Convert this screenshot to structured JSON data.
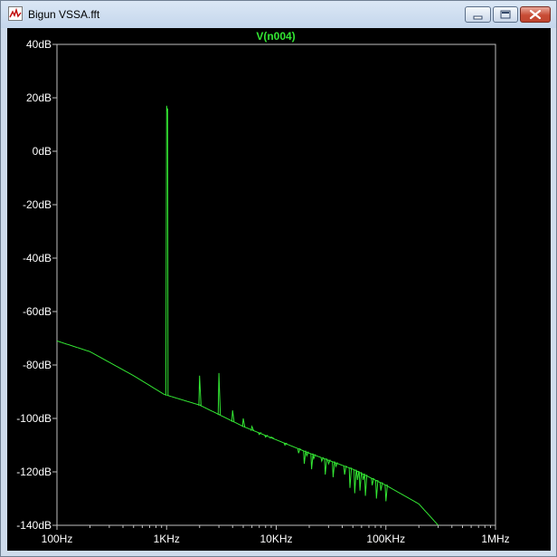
{
  "window": {
    "title": "Bigun VSSA.fft",
    "app_icon": "waveform-icon",
    "controls": [
      "minimize-icon",
      "maximize-icon",
      "close-icon"
    ]
  },
  "colors": {
    "background": "#000000",
    "trace": "#33e633",
    "axis_text": "#ffffff",
    "axis_lines": "#c0c0c0"
  },
  "chart_data": {
    "type": "line",
    "title": "V(n004)",
    "xlabel": "",
    "ylabel": "",
    "x_scale": "log",
    "xlim": [
      100,
      1000000
    ],
    "ylim": [
      -140,
      40
    ],
    "grid": false,
    "legend": "none",
    "x_tick_labels": [
      "100Hz",
      "1KHz",
      "10KHz",
      "100KHz",
      "1MHz"
    ],
    "y_tick_labels": [
      "40dB",
      "20dB",
      "0dB",
      "-20dB",
      "-40dB",
      "-60dB",
      "-80dB",
      "-100dB",
      "-120dB",
      "-140dB"
    ],
    "series": [
      {
        "name": "V(n004)",
        "noise_floor": {
          "x": [
            100,
            200,
            500,
            950,
            2000,
            5000,
            10000,
            20000,
            50000,
            100000,
            200000,
            300000
          ],
          "y": [
            -71,
            -75,
            -84,
            -91,
            -95,
            -103,
            -108,
            -113,
            -119,
            -125,
            -132,
            -140
          ]
        },
        "peaks": [
          {
            "x": 1000,
            "y": 17
          },
          {
            "x": 2000,
            "y": -84
          },
          {
            "x": 3000,
            "y": -83
          },
          {
            "x": 4000,
            "y": -97
          },
          {
            "x": 5000,
            "y": -100
          },
          {
            "x": 6000,
            "y": -103
          },
          {
            "x": 7000,
            "y": -106
          },
          {
            "x": 8000,
            "y": -107
          },
          {
            "x": 9000,
            "y": -107
          },
          {
            "x": 12000,
            "y": -110
          },
          {
            "x": 16000,
            "y": -113
          },
          {
            "x": 19000,
            "y": -114
          },
          {
            "x": 22000,
            "y": -115
          },
          {
            "x": 26000,
            "y": -116
          },
          {
            "x": 30000,
            "y": -117
          },
          {
            "x": 35000,
            "y": -118
          },
          {
            "x": 42000,
            "y": -121
          },
          {
            "x": 55000,
            "y": -123
          },
          {
            "x": 62000,
            "y": -123
          },
          {
            "x": 75000,
            "y": -125
          },
          {
            "x": 90000,
            "y": -127
          }
        ],
        "dips": [
          {
            "x": 18000,
            "y": -117
          },
          {
            "x": 21000,
            "y": -119
          },
          {
            "x": 28000,
            "y": -121
          },
          {
            "x": 33000,
            "y": -122
          },
          {
            "x": 47000,
            "y": -126
          },
          {
            "x": 52000,
            "y": -128
          },
          {
            "x": 58000,
            "y": -127
          },
          {
            "x": 65000,
            "y": -129
          },
          {
            "x": 82000,
            "y": -130
          },
          {
            "x": 100000,
            "y": -131
          }
        ]
      }
    ]
  }
}
